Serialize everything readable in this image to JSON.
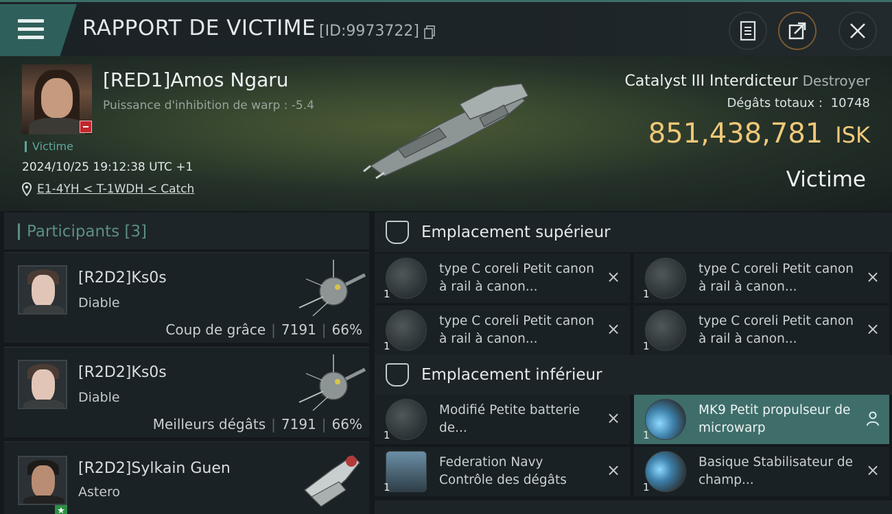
{
  "header": {
    "title": "RAPPORT DE VICTIME",
    "report_id": "[ID:9973722]"
  },
  "victim": {
    "name": "[RED1]Amos Ngaru",
    "warp_strength": "Puissance d'inhibition de warp : -5.4",
    "tag": "Victime",
    "datetime": "2024/10/25 19:12:38 UTC +1",
    "location": "E1-4YH < T-1WDH < Catch",
    "ship_name": "Catalyst III Interdicteur",
    "ship_class": "Destroyer",
    "damage_label": "Dégâts totaux :",
    "damage_value": "10748",
    "isk_value": "851,438,781",
    "isk_unit": "ISK",
    "result_label": "Victime"
  },
  "participants": {
    "label": "Participants",
    "count": "[3]",
    "rows": [
      {
        "name": "[R2D2]Ks0s",
        "ship": "Diable",
        "role": "Coup de grâce",
        "damage": "7191",
        "percent": "66%"
      },
      {
        "name": "[R2D2]Ks0s",
        "ship": "Diable",
        "role": "Meilleurs dégâts",
        "damage": "7191",
        "percent": "66%"
      },
      {
        "name": "[R2D2]Sylkain Guen",
        "ship": "Astero",
        "role": "",
        "damage": "",
        "percent": ""
      }
    ]
  },
  "slots": {
    "upper": {
      "label": "Emplacement supérieur",
      "modules": [
        {
          "qty": "1",
          "name": "type C coreli Petit canon à rail à canon..."
        },
        {
          "qty": "1",
          "name": "type C coreli Petit canon à rail à canon..."
        },
        {
          "qty": "1",
          "name": "type C coreli Petit canon à rail à canon..."
        },
        {
          "qty": "1",
          "name": "type C coreli Petit canon à rail à canon..."
        }
      ]
    },
    "lower": {
      "label": "Emplacement inférieur",
      "modules": [
        {
          "qty": "1",
          "name": "Modifié Petite batterie de..."
        },
        {
          "qty": "1",
          "name": "MK9 Petit propulseur de microwarp"
        },
        {
          "qty": "1",
          "name": "Federation Navy Contrôle des dégâts"
        },
        {
          "qty": "1",
          "name": "Basique Stabilisateur de champ..."
        }
      ]
    }
  },
  "icons": {
    "close": "×",
    "remove": "×"
  },
  "colors": {
    "accent": "#3f6e6a",
    "isk": "#f0c878",
    "victim_tag": "#5fa69a"
  }
}
